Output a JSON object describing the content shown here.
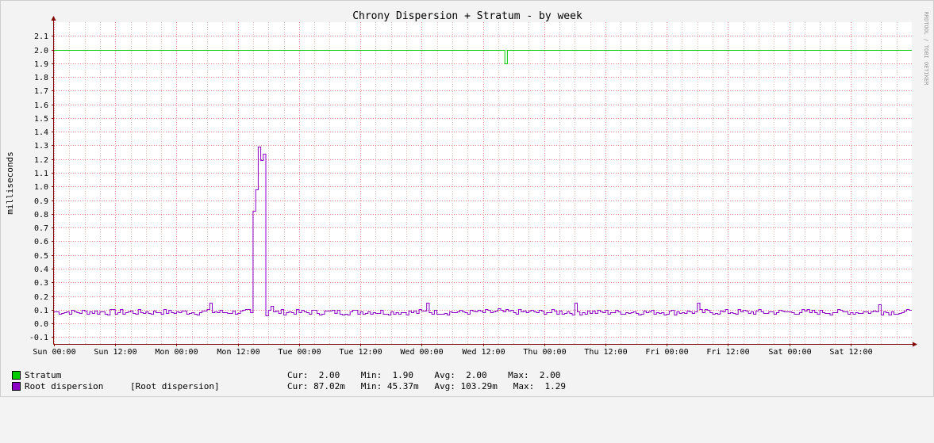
{
  "chart_data": {
    "type": "line",
    "title": "Chrony Dispersion + Stratum - by week",
    "ylabel": "milliseconds",
    "watermark": "RRDTOOL / TOBI OETIKER",
    "ylim": [
      -0.15,
      2.2
    ],
    "yticks": [
      -0.1,
      0.0,
      0.1,
      0.2,
      0.3,
      0.4,
      0.5,
      0.6,
      0.7,
      0.8,
      0.9,
      1.0,
      1.1,
      1.2,
      1.3,
      1.4,
      1.5,
      1.6,
      1.7,
      1.8,
      1.9,
      2.0,
      2.1
    ],
    "x_range_hours": [
      0,
      168
    ],
    "xticks": [
      {
        "hour": 0,
        "label": "Sun 00:00"
      },
      {
        "hour": 12,
        "label": "Sun 12:00"
      },
      {
        "hour": 24,
        "label": "Mon 00:00"
      },
      {
        "hour": 36,
        "label": "Mon 12:00"
      },
      {
        "hour": 48,
        "label": "Tue 00:00"
      },
      {
        "hour": 60,
        "label": "Tue 12:00"
      },
      {
        "hour": 72,
        "label": "Wed 00:00"
      },
      {
        "hour": 84,
        "label": "Wed 12:00"
      },
      {
        "hour": 96,
        "label": "Thu 00:00"
      },
      {
        "hour": 108,
        "label": "Thu 12:00"
      },
      {
        "hour": 120,
        "label": "Fri 00:00"
      },
      {
        "hour": 132,
        "label": "Fri 12:00"
      },
      {
        "hour": 144,
        "label": "Sat 00:00"
      },
      {
        "hour": 156,
        "label": "Sat 12:00"
      }
    ],
    "grid": true,
    "series": [
      {
        "name": "Stratum",
        "color": "#00cc00",
        "style": "step",
        "points": [
          [
            0,
            2.0
          ],
          [
            88.3,
            2.0
          ],
          [
            88.3,
            1.9
          ],
          [
            88.8,
            1.9
          ],
          [
            88.8,
            2.0
          ],
          [
            168,
            2.0
          ]
        ]
      },
      {
        "name": "Root dispersion",
        "color": "#8a00c4",
        "style": "step",
        "baseline": 0.085,
        "variation": 0.02,
        "points": [
          [
            30.5,
            0.15
          ],
          [
            38.8,
            0.08
          ],
          [
            39.3,
            0.82
          ],
          [
            39.6,
            0.98
          ],
          [
            40.0,
            1.13
          ],
          [
            40.4,
            1.29
          ],
          [
            40.8,
            1.19
          ],
          [
            41.3,
            1.24
          ],
          [
            41.7,
            0.06
          ],
          [
            42.2,
            0.1
          ],
          [
            42.7,
            0.13
          ],
          [
            43.3,
            0.09
          ],
          [
            73.2,
            0.15
          ],
          [
            87.0,
            0.11
          ],
          [
            102.3,
            0.15
          ],
          [
            126.2,
            0.15
          ],
          [
            161.8,
            0.14
          ]
        ]
      }
    ],
    "legend": [
      {
        "name": "Stratum",
        "color": "#00cc00",
        "extra": "",
        "stats": "Cur:  2.00    Min:  1.90    Avg:  2.00    Max:  2.00"
      },
      {
        "name": "Root dispersion",
        "color": "#8a00c4",
        "extra": "[Root dispersion]",
        "stats": "Cur: 87.02m   Min: 45.37m   Avg: 103.29m   Max:  1.29"
      }
    ]
  }
}
